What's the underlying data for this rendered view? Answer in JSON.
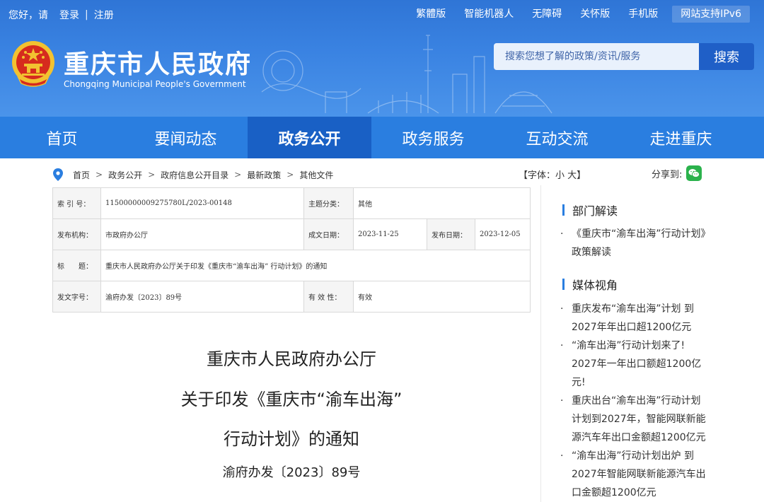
{
  "topbar": {
    "greeting": "您好，请",
    "login": "登录",
    "register": "注册",
    "links": [
      "繁體版",
      "智能机器人",
      "无障碍",
      "关怀版",
      "手机版"
    ],
    "ipv6": "网站支持IPv6"
  },
  "site": {
    "title": "重庆市人民政府",
    "subtitle": "Chongqing Municipal People's Government"
  },
  "search": {
    "placeholder": "搜索您想了解的政策/资讯/服务",
    "button": "搜索"
  },
  "nav": {
    "items": [
      "首页",
      "要闻动态",
      "政务公开",
      "政务服务",
      "互动交流",
      "走进重庆"
    ],
    "active": "政务公开"
  },
  "breadcrumb": [
    "首页",
    "政务公开",
    "政府信息公开目录",
    "最新政策",
    "其他文件"
  ],
  "font_size_control": "【字体：小 大】",
  "share_label": "分享到:",
  "info": {
    "index_label": "索 引 号：",
    "index_value": "11500000009275780L/2023-00148",
    "category_label": "主题分类：",
    "category_value": "其他",
    "issuer_label": "发布机构：",
    "issuer_value": "市政府办公厅",
    "written_label": "成文日期：",
    "written_value": "2023-11-25",
    "published_label": "发布日期：",
    "published_value": "2023-12-05",
    "title_label": "标　　题：",
    "title_value": "重庆市人民政府办公厅关于印发《重庆市“渝车出海” 行动计划》的通知",
    "docno_label": "发文字号：",
    "docno_value": "渝府办发〔2023〕89号",
    "validity_label": "有 效 性：",
    "validity_value": "有效"
  },
  "article": {
    "line1": "重庆市人民政府办公厅",
    "line2": "关于印发《重庆市“渝车出海”",
    "line3": "行动计划》的通知",
    "docno": "渝府办发〔2023〕89号"
  },
  "sidebar": {
    "dept_title": "部门解读",
    "dept_items": [
      "《重庆市“渝车出海”行动计划》政策解读"
    ],
    "media_title": "媒体视角",
    "media_items": [
      "重庆发布“渝车出海”计划 到2027年年出口超1200亿元",
      "“渝车出海”行动计划来了! 2027年一年出口额超1200亿元!",
      "重庆出台“渝车出海”行动计划 计划到2027年，智能网联新能源汽车年出口金额超1200亿元",
      "“渝车出海”行动计划出炉 到2027年智能网联新能源汽车出口金额超1200亿元"
    ]
  },
  "colors": {
    "header_blue": "#3a83e2",
    "nav_blue": "#2a7ee0",
    "nav_active": "#1960c5",
    "search_button": "#1f5fc7",
    "wechat_green": "#2bb24c"
  }
}
